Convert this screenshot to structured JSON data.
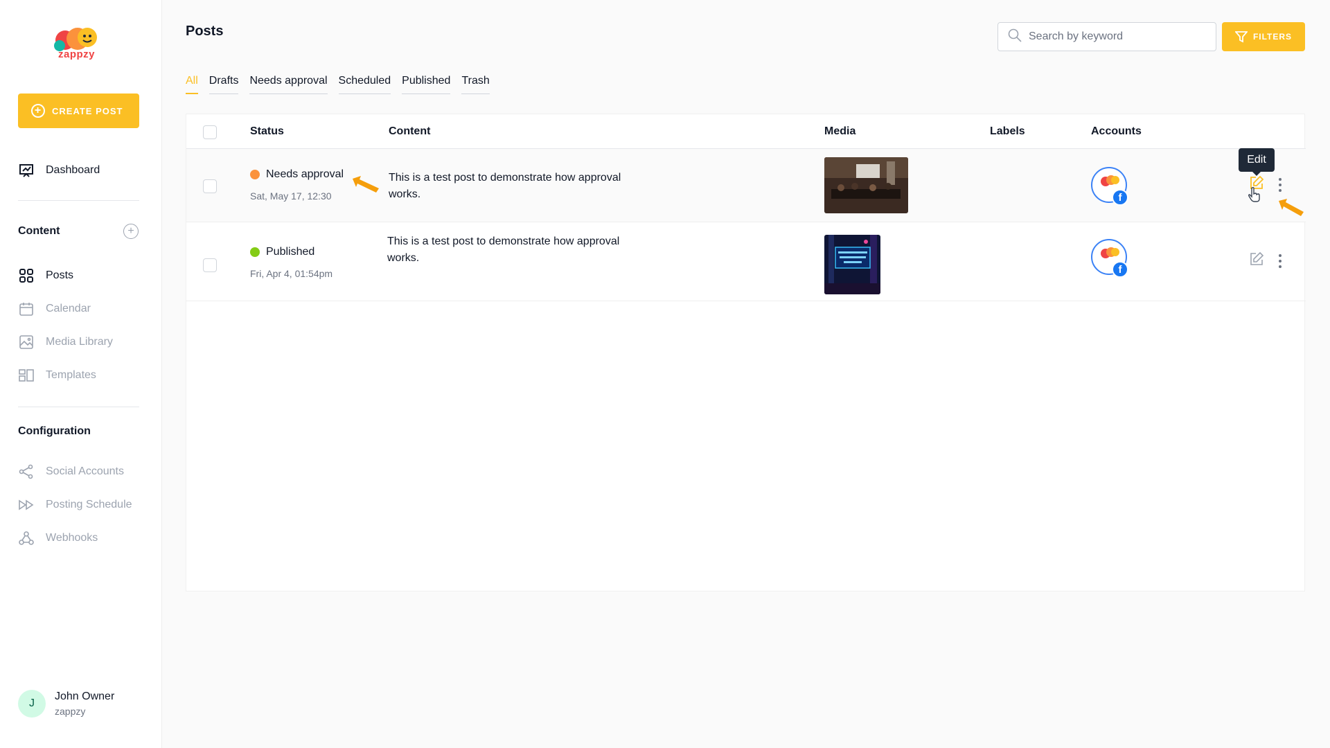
{
  "brand": {
    "name": "zappzy"
  },
  "sidebar": {
    "create_label": "CREATE POST",
    "dashboard": "Dashboard",
    "content_title": "Content",
    "content_items": [
      {
        "label": "Posts",
        "icon": "grid-icon"
      },
      {
        "label": "Calendar",
        "icon": "calendar-icon"
      },
      {
        "label": "Media Library",
        "icon": "image-icon"
      },
      {
        "label": "Templates",
        "icon": "templates-icon"
      }
    ],
    "config_title": "Configuration",
    "config_items": [
      {
        "label": "Social Accounts",
        "icon": "share-icon"
      },
      {
        "label": "Posting Schedule",
        "icon": "fast-forward-icon"
      },
      {
        "label": "Webhooks",
        "icon": "webhook-icon"
      }
    ],
    "user": {
      "initial": "J",
      "name": "John Owner",
      "org": "zappzy"
    }
  },
  "header": {
    "title": "Posts",
    "search_placeholder": "Search by keyword",
    "filters_label": "FILTERS"
  },
  "tabs": [
    "All",
    "Drafts",
    "Needs approval",
    "Scheduled",
    "Published",
    "Trash"
  ],
  "table": {
    "columns": {
      "status": "Status",
      "content": "Content",
      "media": "Media",
      "labels": "Labels",
      "accounts": "Accounts"
    },
    "rows": [
      {
        "status": "Needs approval",
        "status_color": "#fb923c",
        "date": "Sat, May 17, 12:30",
        "content": "This is a test post to demonstrate how approval works."
      },
      {
        "status": "Published",
        "status_color": "#84cc16",
        "date": "Fri, Apr 4, 01:54pm",
        "content": "This is a test post to demonstrate how approval works."
      }
    ]
  },
  "tooltip": "Edit",
  "colors": {
    "accent": "#fbbf24",
    "annotation": "#f59e0b",
    "facebook": "#1877f2"
  }
}
